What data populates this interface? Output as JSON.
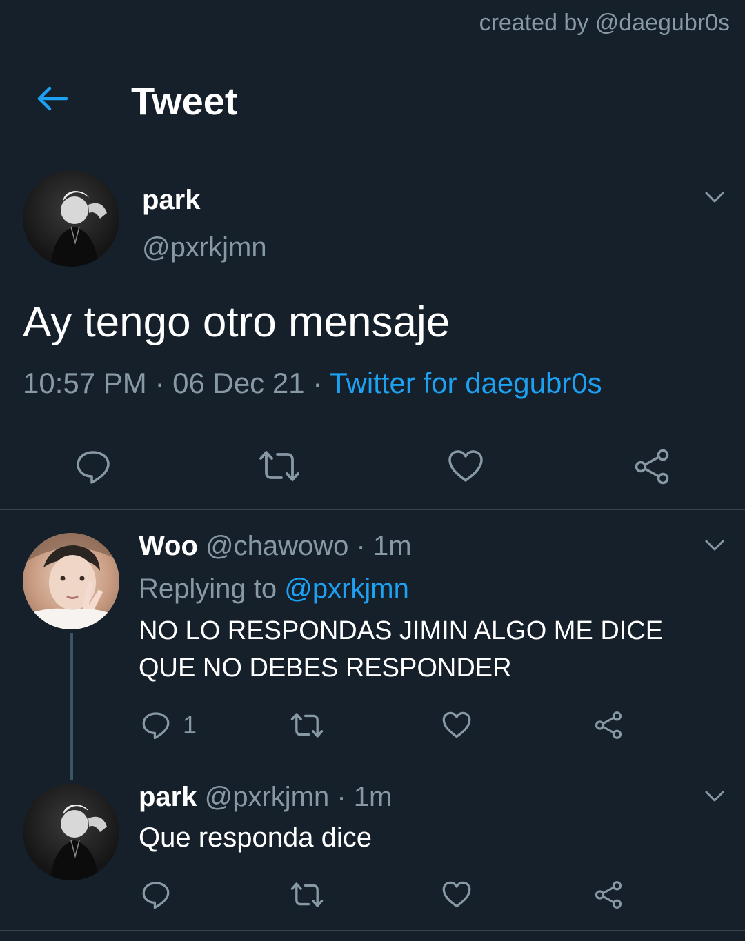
{
  "credit": "created by @daegubr0s",
  "header": {
    "title": "Tweet"
  },
  "main_tweet": {
    "name": "park",
    "handle": "@pxrkjmn",
    "text": "Ay tengo otro mensaje",
    "time": "10:57 PM",
    "date": "06 Dec 21",
    "source": "Twitter for daegubr0s"
  },
  "replies": [
    {
      "name": "Woo",
      "handle": "@chawowo",
      "age": "1m",
      "replying_label": "Replying to",
      "replying_to": "@pxrkjmn",
      "text_line1": "NO LO RESPONDAS JIMIN ALGO ME DICE",
      "text_line2": "QUE NO DEBES RESPONDER",
      "reply_count": "1"
    },
    {
      "name": "park",
      "handle": "@pxrkjmn",
      "age": "1m",
      "text_line1": "Que responda dice"
    }
  ],
  "colors": {
    "background": "#15202b",
    "accent": "#1da1f2",
    "muted": "#8899a6",
    "divider": "#38444d"
  },
  "icons": [
    "back-arrow-icon",
    "chevron-down-icon",
    "reply-icon",
    "retweet-icon",
    "like-icon",
    "share-icon"
  ]
}
